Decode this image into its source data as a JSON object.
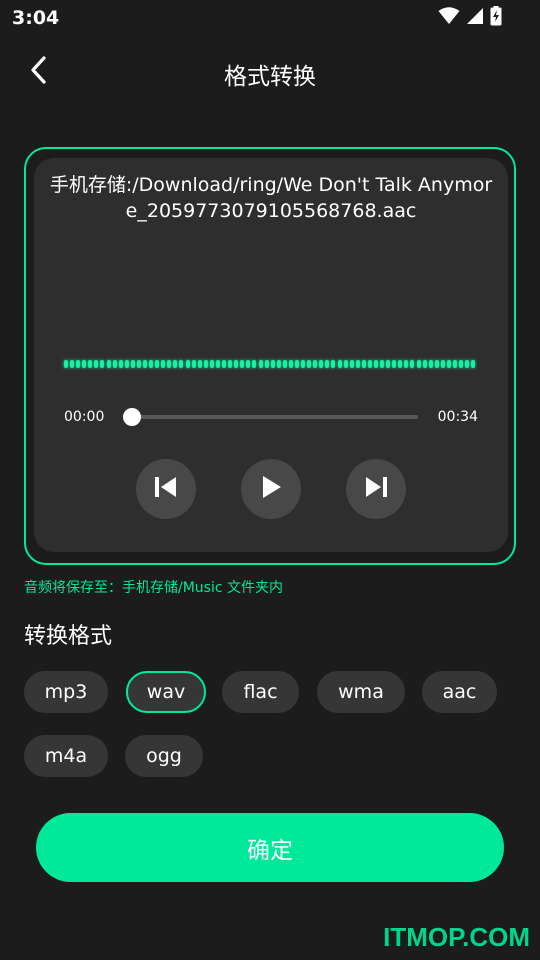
{
  "status_bar": {
    "time": "3:04",
    "icons": [
      "wifi-icon",
      "signal-icon",
      "battery-charging-icon"
    ]
  },
  "header": {
    "title": "格式转换",
    "back_icon": "chevron-left-icon"
  },
  "player": {
    "file_path": "手机存储:/Download/ring/We Don't Talk Anymore_2059773079105568768.aac",
    "current_time": "00:00",
    "total_time": "00:34",
    "progress": 0,
    "controls": [
      "skip-previous-icon",
      "play-icon",
      "skip-next-icon"
    ]
  },
  "save_hint": "音频将保存至：手机存储/Music 文件夹内",
  "formats": {
    "title": "转换格式",
    "selected": "wav",
    "options": [
      "mp3",
      "wav",
      "flac",
      "wma",
      "aac",
      "m4a",
      "ogg"
    ]
  },
  "confirm_label": "确定",
  "watermark": "ITMOP.COM",
  "colors": {
    "accent": "#00e89a",
    "background": "#1c1c1c",
    "card": "#2e2e2e",
    "chip": "#363636",
    "control_button": "#484848"
  }
}
